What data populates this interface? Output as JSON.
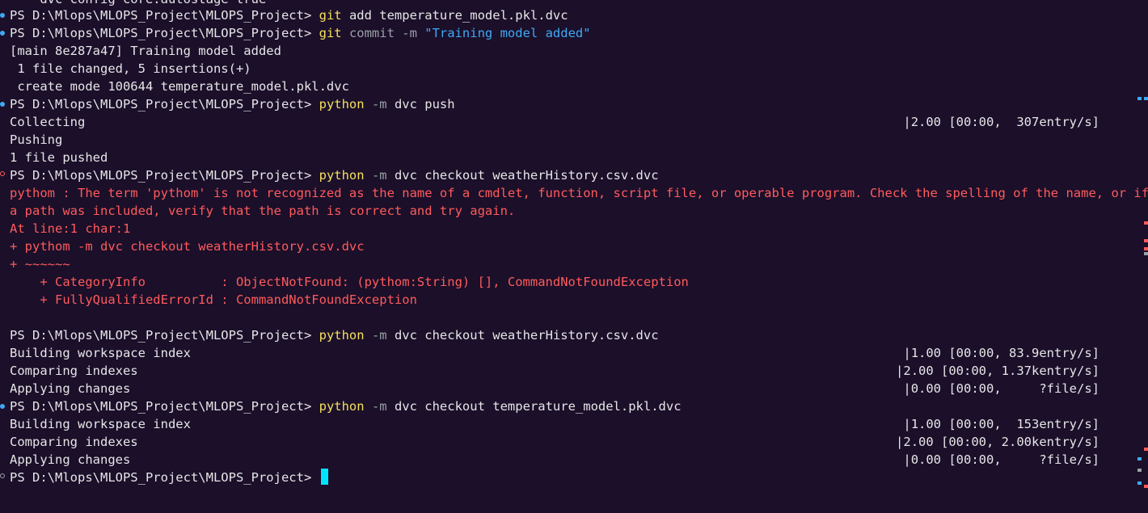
{
  "terminal": {
    "partial_top": "    dvc config core.autostage true",
    "prompt": "PS D:\\Mlops\\MLOPS_Project\\MLOPS_Project> ",
    "lines": {
      "l1": {
        "cmd": "git",
        "args": " add temperature_model.pkl.dvc"
      },
      "l2": {
        "cmd": "git",
        "flag": " commit -m ",
        "str": "\"Training model added\""
      },
      "l3": "[main 8e287a47] Training model added",
      "l4": " 1 file changed, 5 insertions(+)",
      "l5": " create mode 100644 temperature_model.pkl.dvc",
      "l6": {
        "cmd": "python",
        "flag": " -m ",
        "args": "dvc push"
      },
      "l7": {
        "text": "Collecting",
        "progress": "|2.00 [00:00,  307entry/s]"
      },
      "l8": "Pushing",
      "l9": "1 file pushed",
      "l10": {
        "cmd": "python",
        "flag": " -m ",
        "args": "dvc checkout weatherHistory.csv.dvc"
      },
      "e1": "pythom : The term 'pythom' is not recognized as the name of a cmdlet, function, script file, or operable program. Check the spelling of the name, or if",
      "e2": "a path was included, verify that the path is correct and try again.",
      "e3": "At line:1 char:1",
      "e4": "+ pythom -m dvc checkout weatherHistory.csv.dvc",
      "e5": "+ ~~~~~~",
      "e6": "    + CategoryInfo          : ObjectNotFound: (pythom:String) [], CommandNotFoundException",
      "e7": "    + FullyQualifiedErrorId : CommandNotFoundException",
      "l11": {
        "cmd": "python",
        "flag": " -m ",
        "args": "dvc checkout weatherHistory.csv.dvc"
      },
      "l12": {
        "text": "Building workspace index",
        "progress": "|1.00 [00:00, 83.9entry/s]"
      },
      "l13": {
        "text": "Comparing indexes",
        "progress": "|2.00 [00:00, 1.37kentry/s]"
      },
      "l14": {
        "text": "Applying changes",
        "progress": "|0.00 [00:00,     ?file/s]"
      },
      "l15": {
        "cmd": "python",
        "flag": " -m ",
        "args": "dvc checkout temperature_model.pkl.dvc"
      },
      "l16": {
        "text": "Building workspace index",
        "progress": "|1.00 [00:00,  153entry/s]"
      },
      "l17": {
        "text": "Comparing indexes",
        "progress": "|2.00 [00:00, 2.00kentry/s]"
      },
      "l18": {
        "text": "Applying changes",
        "progress": "|0.00 [00:00,     ?file/s]"
      }
    }
  },
  "colors": {
    "background": "#1b0f2a",
    "command": "#f5e05b",
    "string": "#3fa9f5",
    "error": "#ff5b5b",
    "cursor": "#00e5ff"
  }
}
